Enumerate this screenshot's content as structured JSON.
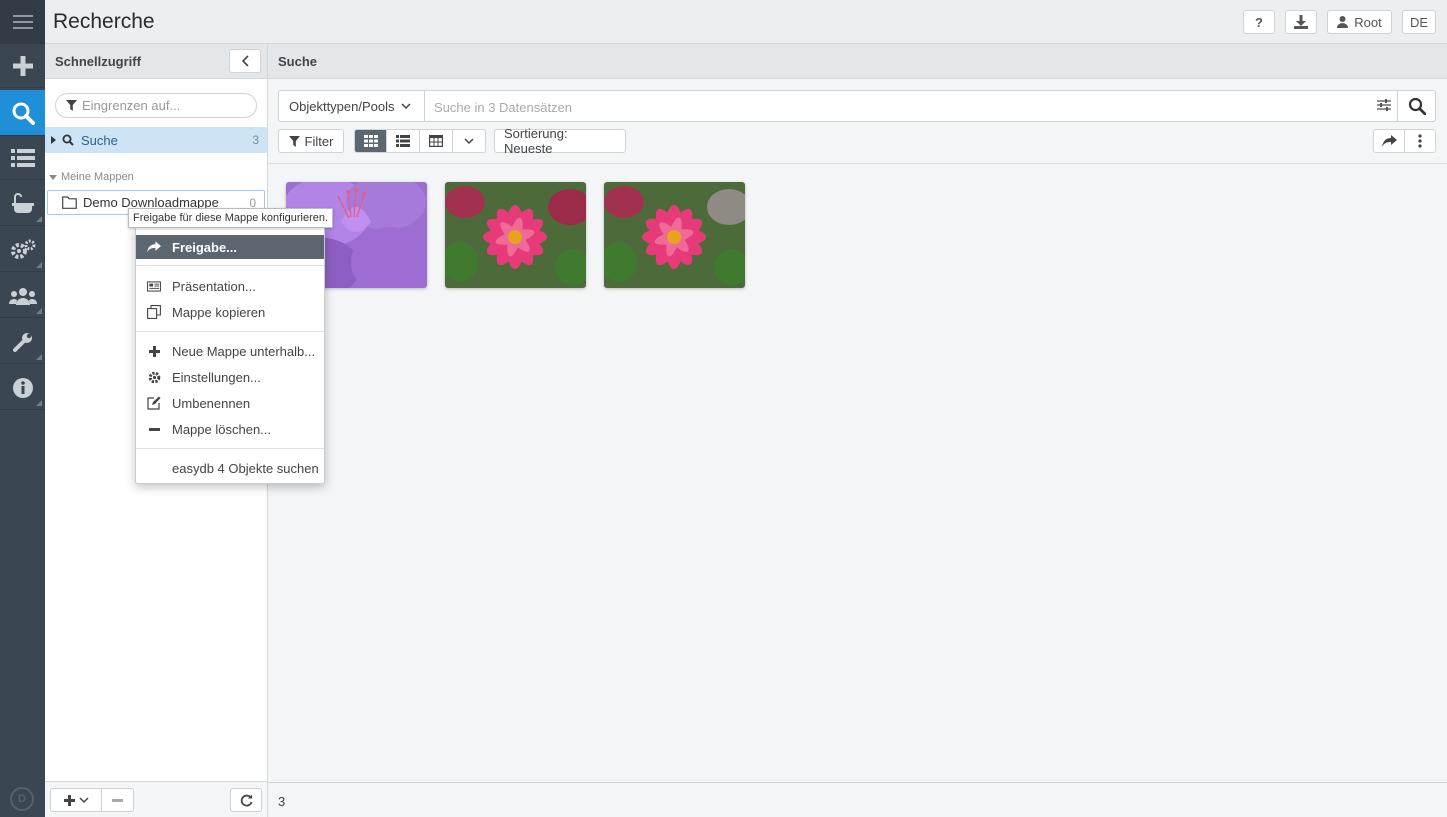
{
  "header": {
    "title": "Recherche",
    "help_label": "?",
    "user_label": "Root",
    "lang_label": "DE"
  },
  "rail": {
    "items": [
      "menu-icon",
      "plus-icon",
      "search-icon",
      "list-icon",
      "bathtub-icon",
      "gears-icon",
      "users-icon",
      "wrench-icon",
      "info-icon"
    ],
    "active": "search-icon",
    "logo": "D"
  },
  "quick_access": {
    "title": "Schnellzugriff",
    "filter_placeholder": "Eingrenzen auf...",
    "search_item": {
      "label": "Suche",
      "count": "3"
    },
    "section_label": "Meine Mappen",
    "folder": {
      "label": "Demo Downloadmappe",
      "count": "0"
    }
  },
  "main": {
    "title": "Suche",
    "objtypes_label": "Objekttypen/Pools",
    "search_placeholder": "Suche in 3 Datensätzen",
    "filter_label": "Filter",
    "sort_label": "Sortierung: Neueste",
    "result_count": "3",
    "thumbnails": [
      {
        "subject": "purple rhododendron"
      },
      {
        "subject": "pink dahlia"
      },
      {
        "subject": "pink dahlia"
      }
    ]
  },
  "tooltip": "Freigabe für diese Mappe konfigurieren.",
  "context_menu": {
    "items": [
      {
        "label": "Freigabe...",
        "icon": "share-icon",
        "active": true
      },
      {
        "label": "Präsentation...",
        "icon": "presentation-icon"
      },
      {
        "label": "Mappe kopieren",
        "icon": "copy-icon"
      },
      {
        "label": "Neue Mappe unterhalb...",
        "icon": "plus-icon"
      },
      {
        "label": "Einstellungen...",
        "icon": "gear-icon"
      },
      {
        "label": "Umbenennen",
        "icon": "edit-icon"
      },
      {
        "label": "Mappe löschen...",
        "icon": "minus-icon"
      },
      {
        "label": "easydb 4 Objekte suchen",
        "icon": ""
      }
    ]
  },
  "colors": {
    "rail": "#3a4651",
    "accent": "#1f8fd8",
    "selected": "#cde3f6",
    "menu_active": "#5b6670"
  }
}
